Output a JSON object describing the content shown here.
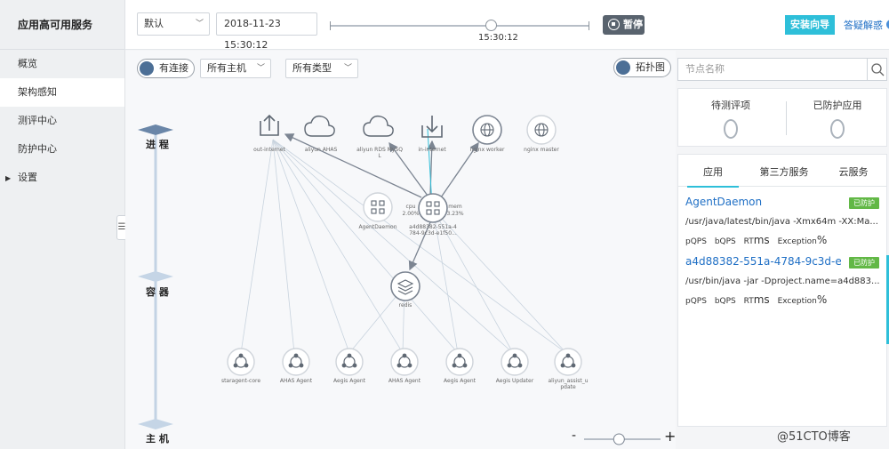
{
  "sidebar": {
    "title": "应用高可用服务",
    "items": [
      {
        "label": "概览"
      },
      {
        "label": "架构感知"
      },
      {
        "label": "测评中心"
      },
      {
        "label": "防护中心"
      },
      {
        "label": "设置"
      }
    ],
    "collapse_glyph": "☰"
  },
  "topbar": {
    "env_select": "默认",
    "datetime": "2018-11-23 15:30:12",
    "slider_time": "15:30:12",
    "slider_position": 0.62,
    "pause_label": "暂停",
    "install_label": "安装向导",
    "faq_label": "答疑解惑"
  },
  "canvas": {
    "toggle_connected": "有连接",
    "filter_hosts": "所有主机",
    "filter_types": "所有类型",
    "toggle_topology": "拓扑图",
    "layers": {
      "process": "进 程",
      "container": "容 器",
      "host": "主 机"
    },
    "zoom_minus": "-",
    "zoom_plus": "+",
    "zoom_level": 0.45
  },
  "nodes": {
    "out_internet": "out-internet",
    "aliyun_ahas": "aliyun AHAS",
    "aliyun_rds": "aliyun RDS MySQ",
    "aliyun_rds_2": "L",
    "in_internet": "in-internet",
    "nginx_worker": "nginx worker",
    "nginx_master": "nginx master",
    "agentdaemon": "AgentDaemon",
    "container_name": "a4d88382-551a-4",
    "container_name_2": "784-9c3d-e1f50...",
    "cpu_label": "cpu",
    "cpu_value": "2.00%",
    "mem_label": "mem",
    "mem_value": "3.23%",
    "redis": "redis",
    "hosts": [
      "staragent-core",
      "AHAS Agent",
      "Aegis Agent",
      "AHAS Agent",
      "Aegis Agent",
      "Aegis Updater",
      "aliyun_assist_u"
    ],
    "host_last_2": "pdate"
  },
  "right": {
    "search_placeholder": "节点名称",
    "stats": [
      {
        "label": "待测评项",
        "value": "0"
      },
      {
        "label": "已防护应用",
        "value": "0"
      }
    ],
    "tabs": [
      {
        "label": "应用"
      },
      {
        "label": "第三方服务"
      },
      {
        "label": "云服务"
      }
    ],
    "apps": [
      {
        "name": "AgentDaemon",
        "badge": "已防护",
        "cmd": "/usr/java/latest/bin/java -Xmx64m -XX:Ma...",
        "pqps": "pQPS",
        "bqps": "bQPS",
        "rt": "RT",
        "rt_unit": "ms",
        "exception": "Exception",
        "exception_unit": "%"
      },
      {
        "name": "a4d88382-551a-4784-9c3d-e...",
        "badge": "已防护",
        "cmd": "/usr/bin/java -jar -Dproject.name=a4d883...",
        "pqps": "pQPS",
        "bqps": "bQPS",
        "rt": "RT",
        "rt_unit": "ms",
        "exception": "Exception",
        "exception_unit": "%"
      }
    ]
  },
  "watermark": "@51CTO博客",
  "colors": {
    "accent": "#2ebfd9",
    "link": "#1f6fc5",
    "protected": "#62b846",
    "pause": "#59636e"
  }
}
